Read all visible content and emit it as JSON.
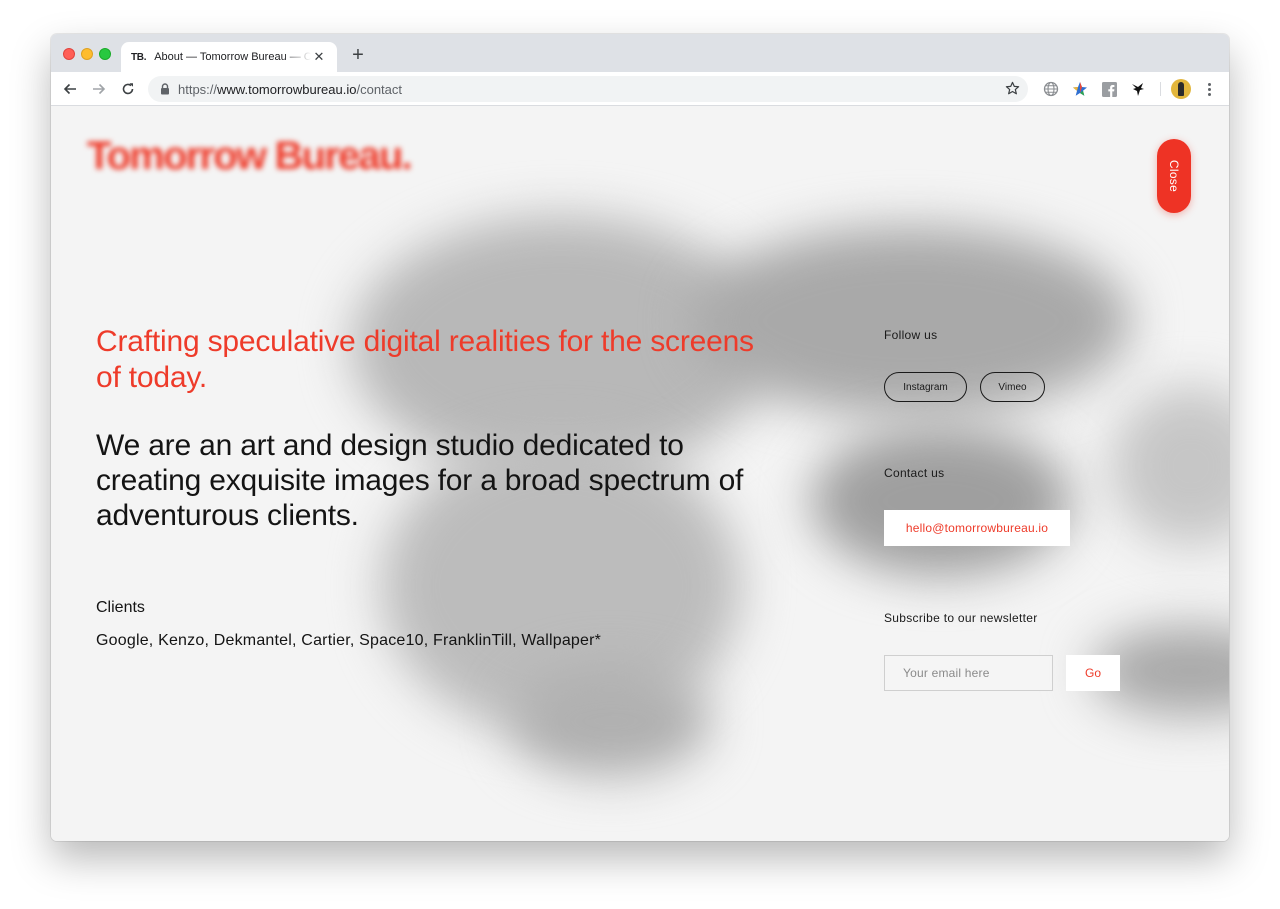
{
  "browser": {
    "tab": {
      "favicon_text": "TB.",
      "title": "About — Tomorrow Bureau — Crafting speculative digital realities",
      "close_glyph": "✕"
    },
    "new_tab_glyph": "+",
    "url": {
      "scheme": "https://",
      "host": "www.tomorrowbureau.io",
      "path": "/contact"
    }
  },
  "page": {
    "logo": "Tomorrow Bureau.",
    "close_button": "Close",
    "headline_red": "Crafting speculative digital realities for the screens of today.",
    "headline_black": "We are an art and design studio dedicated to creating exquisite images for a broad spectrum of adventurous clients.",
    "clients": {
      "label": "Clients",
      "list": "Google, Kenzo, Dekmantel, Cartier, Space10, FranklinTill, Wallpaper*"
    },
    "follow": {
      "label": "Follow us",
      "links": [
        "Instagram",
        "Vimeo"
      ]
    },
    "contact": {
      "label": "Contact us",
      "email": "hello@tomorrowbureau.io"
    },
    "newsletter": {
      "label": "Subscribe to our newsletter",
      "placeholder": "Your email here",
      "button": "Go"
    }
  },
  "colors": {
    "accent": "#ee3b2a",
    "page_background": "#f4f4f4"
  }
}
